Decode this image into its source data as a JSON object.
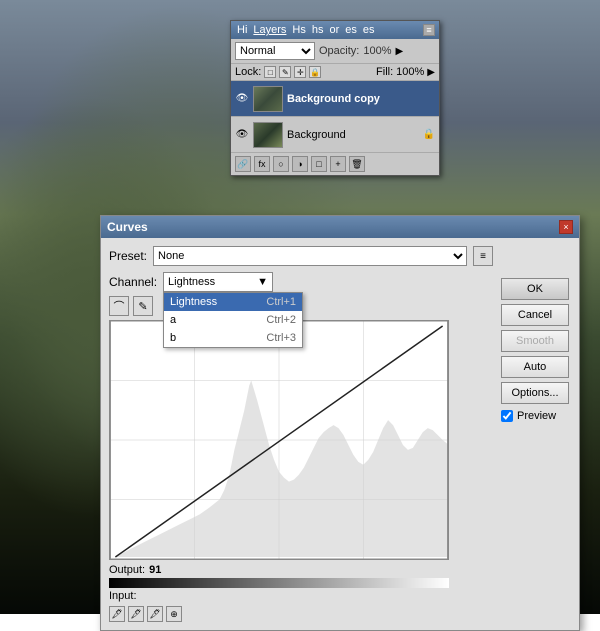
{
  "background": {
    "description": "Mountain landscape background"
  },
  "layers_panel": {
    "title": "Layers",
    "tabs": [
      "Hi",
      "Layers",
      "Hs",
      "hs",
      "or",
      "es",
      "es"
    ],
    "blend_mode": "Normal",
    "opacity_label": "Opacity:",
    "opacity_value": "100%",
    "lock_label": "Lock:",
    "fill_label": "Fill:",
    "fill_value": "100%",
    "layers": [
      {
        "name": "Background copy",
        "selected": true,
        "visible": true
      },
      {
        "name": "Background",
        "selected": false,
        "visible": true,
        "locked": true
      }
    ]
  },
  "curves_dialog": {
    "title": "Curves",
    "close_label": "×",
    "preset_label": "Preset:",
    "preset_value": "None",
    "channel_label": "Channel:",
    "channel_value": "Lightness",
    "channel_options": [
      {
        "name": "Lightness",
        "shortcut": "Ctrl+1"
      },
      {
        "name": "a",
        "shortcut": "Ctrl+2"
      },
      {
        "name": "b",
        "shortcut": "Ctrl+3"
      }
    ],
    "output_label": "Output:",
    "output_value": "91",
    "input_label": "Input:",
    "buttons": {
      "ok": "OK",
      "cancel": "Cancel",
      "smooth": "Smooth",
      "auto": "Auto",
      "options": "Options..."
    },
    "preview_label": "Preview",
    "preview_checked": true
  }
}
